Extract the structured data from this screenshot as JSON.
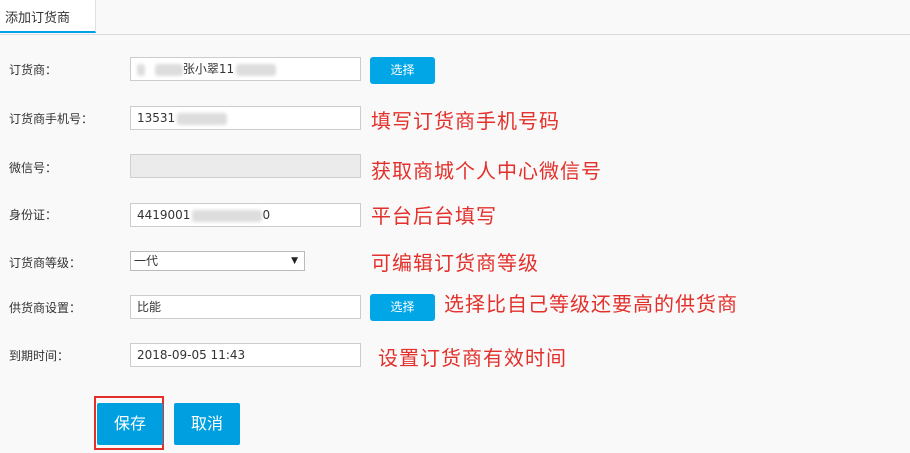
{
  "tab": {
    "label": "添加订货商"
  },
  "fields": {
    "dealer": {
      "label": "订货商：",
      "value_visible": "张小翠11"
    },
    "phone": {
      "label": "订货商手机号：",
      "value_visible": "13531"
    },
    "wechat": {
      "label": "微信号：",
      "value": ""
    },
    "id_card": {
      "label": "身份证：",
      "value_visible": "4419001",
      "value_tail": "0"
    },
    "level": {
      "label": "订货商等级：",
      "selected": "一代"
    },
    "supplier": {
      "label": "供货商设置：",
      "value": "比能"
    },
    "expiry": {
      "label": "到期时间：",
      "value": "2018-09-05 11:43"
    }
  },
  "buttons": {
    "select": "选择",
    "save": "保存",
    "cancel": "取消"
  },
  "annotations": {
    "phone": "填写订货商手机号码",
    "wechat": "获取商城个人中心微信号",
    "id_card": "平台后台填写",
    "level": "可编辑订货商等级",
    "supplier": "选择比自己等级还要高的供货商",
    "expiry": "设置订货商有效时间"
  },
  "colors": {
    "accent": "#00a6e6",
    "annotation": "#e3302b"
  }
}
